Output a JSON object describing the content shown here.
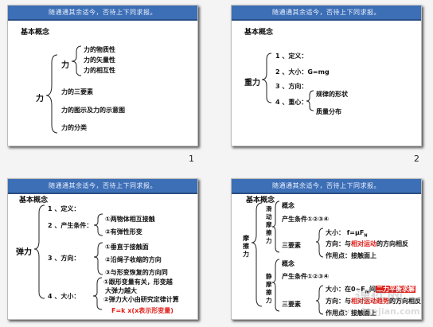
{
  "banner": "随通通其余适今，否待上下同求报。",
  "slide1": {
    "title": "基本概念",
    "root": "力",
    "sub": "力",
    "props": [
      "力的物质性",
      "力的矢量性",
      "力的相互性"
    ],
    "items": [
      "力的三要素",
      "力的图示及力的示意图",
      "力的分类"
    ],
    "page": "1"
  },
  "slide2": {
    "title": "基本概念",
    "root": "重力",
    "items": [
      "1 、定义：",
      "2 、大小：G=mg",
      "3 、方向：",
      "4 、重心："
    ],
    "center": [
      "规律的形状",
      "质量分布"
    ],
    "page": "2"
  },
  "slide3": {
    "title": "基本概念",
    "root": "弹力",
    "items": [
      "1 、定义：",
      "2 、产生条件：",
      "3 、方向：",
      "4 、大小："
    ],
    "cond": [
      "①两物体相互接触",
      "②有弹性形变"
    ],
    "dir": [
      "①垂直于接触面",
      "②沿绳子收缩的方向",
      "③与形变恢复的方向同"
    ],
    "size1": "①跟形变量有关，形变越",
    "size1b": "大弹力越大",
    "size2": "②弹力大小由研究定律计算",
    "formula": "F=k x(x表示形变量)"
  },
  "slide4": {
    "title": "基本概念",
    "root": "摩擦力",
    "slide_label": "滑动摩擦力",
    "static_label": "静摩擦力",
    "concept": "概念",
    "cond": "产生条件①②③④",
    "three": "三要素",
    "s_size": "大小：   f=μF",
    "s_size_sub": "N",
    "s_dir_a": "方向：与",
    "s_dir_red": "相对运动",
    "s_dir_b": "的方向相反",
    "s_point": "作用点：接触面上",
    "t_concept": "概念",
    "t_cond": "产生条件①②③④",
    "t_three": "三要素",
    "t_size_a": "大小：在0~F",
    "t_size_sub": "m",
    "t_size_b": "间",
    "t_size_red": "二力平衡求解",
    "t_dir_a": "方向：与",
    "t_dir_red": "相对运动趋势",
    "t_dir_b": "的方向相反",
    "t_point": "作用点：接触面上"
  },
  "watermark": {
    "top": "课件网",
    "bottom": "www.1kejian.com"
  }
}
